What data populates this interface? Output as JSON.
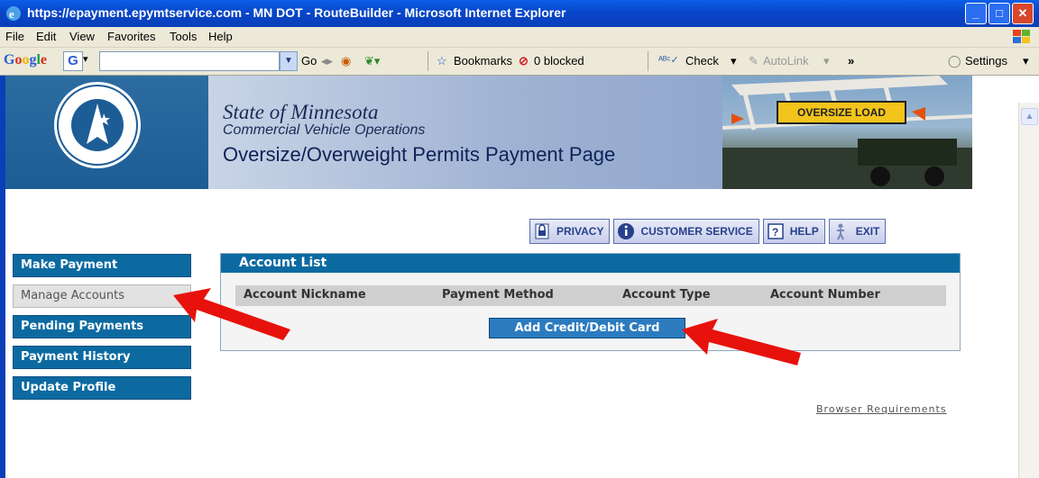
{
  "window": {
    "title": "https://epayment.epymtservice.com - MN DOT - RouteBuilder - Microsoft Internet Explorer",
    "buttons": {
      "minimize": "_",
      "maximize": "□",
      "close": "✕"
    }
  },
  "menubar": {
    "items": [
      "File",
      "Edit",
      "View",
      "Favorites",
      "Tools",
      "Help"
    ]
  },
  "google_toolbar": {
    "logo": "Google",
    "go_label": "Go",
    "bookmarks_label": "Bookmarks",
    "blocked_label": "0 blocked",
    "check_label": "Check",
    "autolink_label": "AutoLink",
    "settings_label": "Settings",
    "more_label": "»"
  },
  "banner": {
    "state": "State of Minnesota",
    "cvo": "Commercial Vehicle Operations",
    "page_title": "Oversize/Overweight Permits Payment Page",
    "truck_sign": "OVERSIZE LOAD"
  },
  "topnav": {
    "privacy": "PRIVACY",
    "customer_service": "CUSTOMER SERVICE",
    "help": "HELP",
    "exit": "EXIT"
  },
  "sidenav": {
    "items": [
      "Make Payment",
      "Manage Accounts",
      "Pending Payments",
      "Payment History",
      "Update Profile"
    ],
    "active": "Manage Accounts"
  },
  "account_list": {
    "title": "Account List",
    "columns": [
      "Account Nickname",
      "Payment Method",
      "Account Type",
      "Account Number"
    ],
    "add_button": "Add Credit/Debit Card"
  },
  "footer": {
    "browser_requirements": "Browser Requirements"
  },
  "colors": {
    "nav_blue": "#0c6aa1",
    "arrow_red": "#e8120c",
    "title_blue": "#0846c9"
  }
}
